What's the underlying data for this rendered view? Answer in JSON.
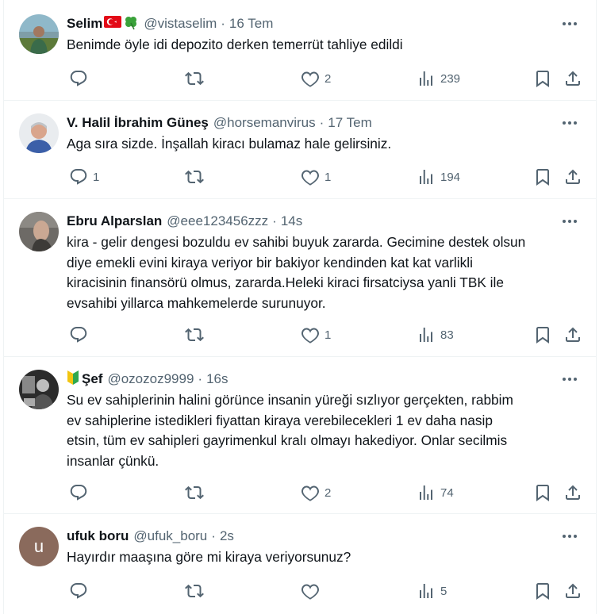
{
  "tweets": [
    {
      "name": "Selim",
      "emoji": [
        "turkish-flag",
        "four-leaf-clover"
      ],
      "handle": "@vistaselim",
      "time": "16 Tem",
      "text": "Benimde öyle idi depozito derken temerrüt tahliye edildi",
      "replies": "",
      "retweets": "",
      "likes": "2",
      "views": "239"
    },
    {
      "name": "V. Halil İbrahim Güneş",
      "handle": "@horsemanvirus",
      "time": "17 Tem",
      "text": "Aga sıra sizde. İnşallah kiracı bulamaz hale gelirsiniz.",
      "replies": "1",
      "retweets": "",
      "likes": "1",
      "views": "194"
    },
    {
      "name": "Ebru Alparslan",
      "handle": "@eee123456zzz",
      "time": "14s",
      "text": "kira - gelir dengesi bozuldu ev sahibi buyuk zararda. Gecimine destek olsun\ndiye emekli evini kiraya veriyor bir bakiyor kendinden kat kat varlikli\nkiracisinin finansörü olmus, zararda.Heleki kiraci firsatciysa yanli TBK ile\nevsahibi yillarca mahkemelerde surunuyor.",
      "replies": "",
      "retweets": "",
      "likes": "1",
      "views": "83"
    },
    {
      "name": "Şef",
      "name_prefix_emoji": "beginner-symbol",
      "handle": "@ozozoz9999",
      "time": "16s",
      "text": "Su ev sahiplerinin halini görünce insanin yüreği sızlıyor gerçekten, rabbim\nev sahiplerine istedikleri fiyattan kiraya verebilecekleri 1 ev daha nasip\netsin, tüm ev sahipleri gayrimenkul kralı olmayı hakediyor. Onlar secilmis\ninsanlar çünkü.",
      "replies": "",
      "retweets": "",
      "likes": "2",
      "views": "74"
    },
    {
      "name": "ufuk boru",
      "avatar_letter": "u",
      "handle": "@ufuk_boru",
      "time": "2s",
      "text": "Hayırdır maaşına göre mi kiraya veriyorsunuz?",
      "replies": "",
      "retweets": "",
      "likes": "",
      "views": "5"
    }
  ],
  "separator": "·",
  "colors": {
    "text": "#0f1419",
    "secondary": "#536471",
    "divider": "#eff3f4",
    "avatar_letter_bg": "#8a6a5c"
  }
}
